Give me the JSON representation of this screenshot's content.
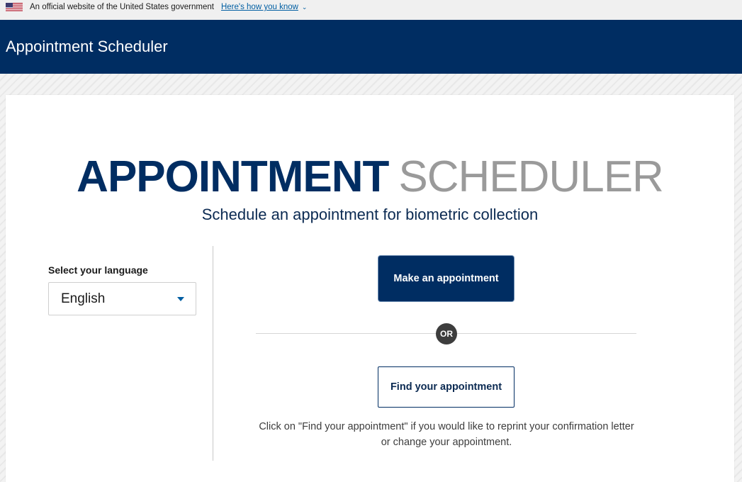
{
  "gov_banner": {
    "text": "An official website of the United States government",
    "link_label": "Here's how you know"
  },
  "header": {
    "title": "Appointment Scheduler"
  },
  "hero": {
    "title_bold": "APPOINTMENT",
    "title_light": "SCHEDULER",
    "subtitle": "Schedule an appointment for biometric collection"
  },
  "language": {
    "label": "Select your language",
    "selected": "English"
  },
  "actions": {
    "make_label": "Make an appointment",
    "or_label": "OR",
    "find_label": "Find your appointment",
    "help_text": "Click on \"Find your appointment\" if you would like to reprint your confirmation letter or change your appointment."
  },
  "colors": {
    "header_bg": "#002d62",
    "primary_button": "#002d62",
    "link": "#005ea2",
    "title_light": "#9a9a9a"
  }
}
